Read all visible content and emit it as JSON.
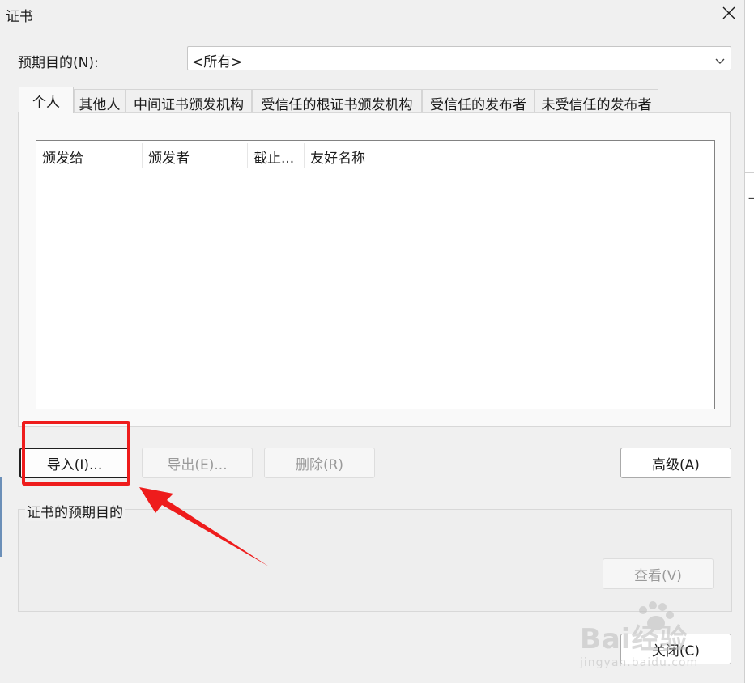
{
  "window": {
    "title": "证书"
  },
  "purpose": {
    "label": "预期目的(N):",
    "selected": "<所有>"
  },
  "tabs": [
    {
      "label": "个人"
    },
    {
      "label": "其他人"
    },
    {
      "label": "中间证书颁发机构"
    },
    {
      "label": "受信任的根证书颁发机构"
    },
    {
      "label": "受信任的发布者"
    },
    {
      "label": "未受信任的发布者"
    }
  ],
  "list": {
    "columns": [
      "颁发给",
      "颁发者",
      "截止...",
      "友好名称"
    ]
  },
  "buttons": {
    "import": "导入(I)...",
    "export": "导出(E)...",
    "remove": "删除(R)",
    "advanced": "高级(A)",
    "view": "查看(V)",
    "close": "关闭(C)"
  },
  "purpose_group": {
    "label": "证书的预期目的"
  },
  "watermark": {
    "brand": "Bai经验",
    "sub": "jingyan.baidu.com"
  },
  "colors": {
    "annotation": "#ee1c1c",
    "focus_border": "#1f1f1f"
  },
  "icons": {
    "close": "close-icon",
    "dropdown": "chevron-down-icon"
  }
}
